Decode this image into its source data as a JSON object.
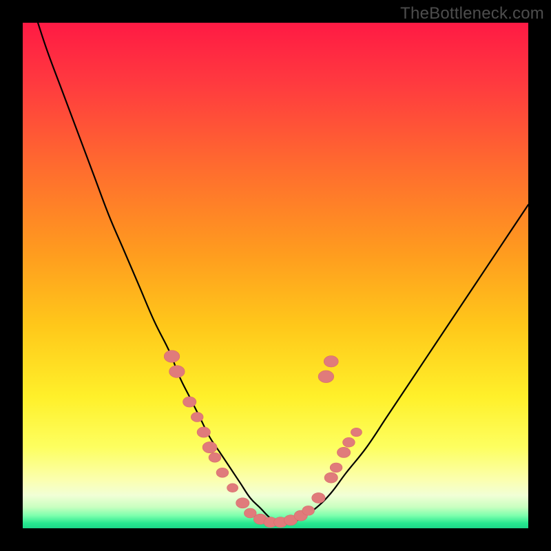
{
  "watermark": "TheBottleneck.com",
  "colors": {
    "frame": "#000000",
    "curve": "#000000",
    "dot_fill": "#e07b7b",
    "dot_stroke": "#d86a6a",
    "gradient_stops": [
      {
        "offset": 0.0,
        "color": "#ff1a44"
      },
      {
        "offset": 0.12,
        "color": "#ff3a3f"
      },
      {
        "offset": 0.28,
        "color": "#ff6a2f"
      },
      {
        "offset": 0.45,
        "color": "#ff9a1f"
      },
      {
        "offset": 0.6,
        "color": "#ffc81a"
      },
      {
        "offset": 0.74,
        "color": "#fff02a"
      },
      {
        "offset": 0.84,
        "color": "#fdff60"
      },
      {
        "offset": 0.905,
        "color": "#fbffb0"
      },
      {
        "offset": 0.935,
        "color": "#f1ffd6"
      },
      {
        "offset": 0.958,
        "color": "#c9ffc0"
      },
      {
        "offset": 0.975,
        "color": "#7dffad"
      },
      {
        "offset": 0.99,
        "color": "#27e88f"
      },
      {
        "offset": 1.0,
        "color": "#1dd789"
      }
    ]
  },
  "chart_data": {
    "type": "line",
    "title": "",
    "xlabel": "",
    "ylabel": "",
    "xlim": [
      0,
      100
    ],
    "ylim": [
      0,
      100
    ],
    "grid": false,
    "legend": false,
    "series": [
      {
        "name": "bottleneck-curve",
        "x": [
          3,
          5,
          8,
          11,
          14,
          17,
          20,
          23,
          26,
          29,
          31,
          33,
          35,
          37,
          39,
          41,
          43,
          45,
          47,
          49,
          51,
          53,
          55,
          58,
          61,
          64,
          68,
          72,
          76,
          80,
          84,
          88,
          92,
          96,
          100
        ],
        "y": [
          100,
          94,
          86,
          78,
          70,
          62,
          55,
          48,
          41,
          35,
          30,
          26,
          22,
          18,
          15,
          12,
          9,
          6,
          4,
          2,
          1,
          1,
          2,
          4,
          7,
          11,
          16,
          22,
          28,
          34,
          40,
          46,
          52,
          58,
          64
        ]
      }
    ],
    "dots": [
      {
        "x": 29.5,
        "y": 34,
        "r": 1.4
      },
      {
        "x": 30.5,
        "y": 31,
        "r": 1.4
      },
      {
        "x": 33.0,
        "y": 25,
        "r": 1.2
      },
      {
        "x": 34.5,
        "y": 22,
        "r": 1.1
      },
      {
        "x": 35.8,
        "y": 19,
        "r": 1.2
      },
      {
        "x": 37.0,
        "y": 16,
        "r": 1.3
      },
      {
        "x": 38.0,
        "y": 14,
        "r": 1.1
      },
      {
        "x": 39.5,
        "y": 11,
        "r": 1.1
      },
      {
        "x": 41.5,
        "y": 8,
        "r": 1.0
      },
      {
        "x": 43.5,
        "y": 5,
        "r": 1.2
      },
      {
        "x": 45.0,
        "y": 3,
        "r": 1.1
      },
      {
        "x": 47.0,
        "y": 1.8,
        "r": 1.2
      },
      {
        "x": 49.0,
        "y": 1.2,
        "r": 1.2
      },
      {
        "x": 51.0,
        "y": 1.2,
        "r": 1.2
      },
      {
        "x": 53.0,
        "y": 1.6,
        "r": 1.2
      },
      {
        "x": 55.0,
        "y": 2.5,
        "r": 1.2
      },
      {
        "x": 56.5,
        "y": 3.5,
        "r": 1.1
      },
      {
        "x": 58.5,
        "y": 6,
        "r": 1.2
      },
      {
        "x": 61.0,
        "y": 10,
        "r": 1.2
      },
      {
        "x": 62.0,
        "y": 12,
        "r": 1.1
      },
      {
        "x": 63.5,
        "y": 15,
        "r": 1.2
      },
      {
        "x": 64.5,
        "y": 17,
        "r": 1.1
      },
      {
        "x": 66.0,
        "y": 19,
        "r": 1.0
      },
      {
        "x": 60.0,
        "y": 30,
        "r": 1.4
      },
      {
        "x": 61.0,
        "y": 33,
        "r": 1.3
      }
    ],
    "annotations": []
  }
}
